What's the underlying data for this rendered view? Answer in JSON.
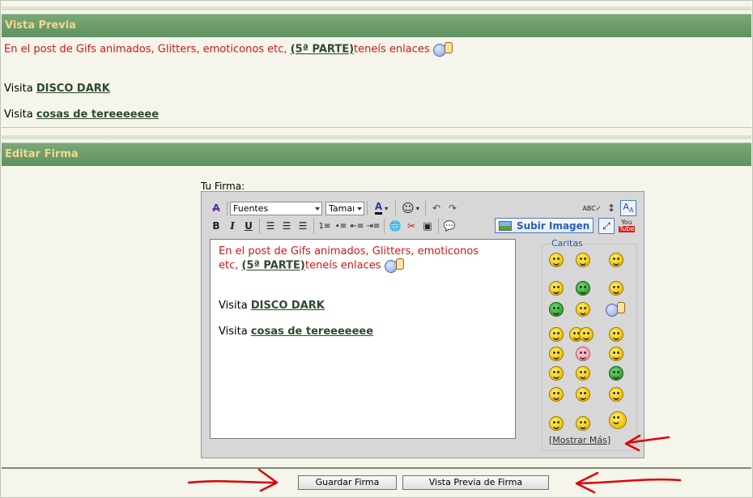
{
  "preview": {
    "header": "Vista Previa",
    "line1": "En el post de Gifs animados, Glitters, emoticonos etc,",
    "line1_link": "(5ª PARTE)",
    "line1_tail": "teneís enlaces",
    "visit1_prefix": "Visita",
    "visit1_link": "DISCO DARK",
    "visit2_prefix": "Visita",
    "visit2_link": "cosas de tereeeeeee"
  },
  "edit": {
    "header": "Editar Firma",
    "label": "Tu Firma:",
    "toolbar": {
      "font_select": "Fuentes",
      "size_select": "Tamaı",
      "upload_button": "Subir Imagen"
    },
    "content": {
      "line1": "En el post de Gifs animados, Glitters, emoticonos",
      "line2_prefix": "etc,",
      "line2_link": "(5ª PARTE)",
      "line2_tail": "teneís enlaces",
      "visit1_prefix": "Visita",
      "visit1_link": "DISCO DARK",
      "visit2_prefix": "Visita",
      "visit2_link": "cosas de tereeeeeee"
    },
    "emoticons": {
      "title": "Caritas",
      "more_open": "[",
      "more_link": "Mostrar Más",
      "more_close": "]"
    }
  },
  "buttons": {
    "save": "Guardar Firma",
    "preview": "Vista Previa de Firma"
  },
  "colors": {
    "header_bg": "#6b9c6a",
    "header_text": "#f2d88a",
    "red_text": "#d21616",
    "link_text": "#2e4a2e",
    "annotation_arrows": "#e00000"
  }
}
